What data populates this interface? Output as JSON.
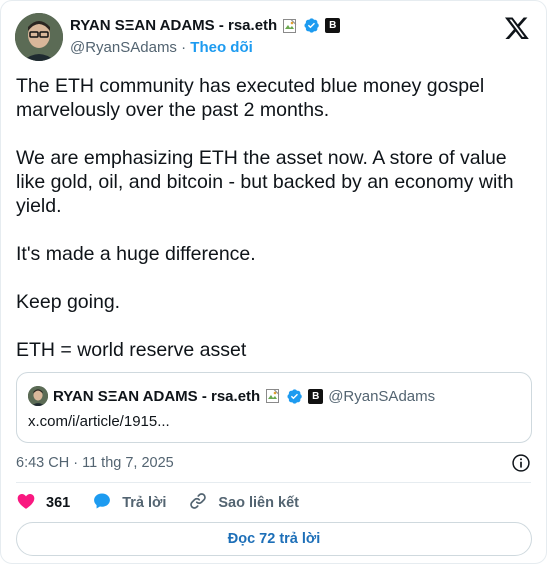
{
  "author": {
    "name": "RYAN SΞAN ADAMS - rsa.eth",
    "handle": "@RyanSAdams",
    "separator": "·",
    "follow_label": "Theo dõi",
    "badge_letter": "B"
  },
  "tweet": {
    "paragraphs": [
      "The ETH community has executed blue money gospel marvelously over the past 2 months.",
      "We are emphasizing ETH the asset now. A store of value like gold, oil, and bitcoin - but backed by an economy with yield.",
      "It's made a huge difference.",
      "Keep going.",
      "ETH = world reserve asset"
    ],
    "timestamp": "6:43 CH · 11 thg 7, 2025"
  },
  "quote": {
    "name": "RYAN SΞAN ADAMS - rsa.eth",
    "handle": "@RyanSAdams",
    "badge_letter": "B",
    "link": "x.com/i/article/1915..."
  },
  "actions": {
    "like_count": "361",
    "reply_label": "Trả lời",
    "copy_link_label": "Sao liên kết"
  },
  "read_replies_label": "Đọc 72 trả lời",
  "colors": {
    "accent": "#1d9bf0",
    "like": "#f91880",
    "text": "#0f1419",
    "muted": "#536471"
  },
  "icons": [
    "x-logo-icon",
    "verified-badge-icon",
    "broken-image-icon",
    "info-icon",
    "heart-icon",
    "reply-bubble-icon",
    "link-icon"
  ]
}
